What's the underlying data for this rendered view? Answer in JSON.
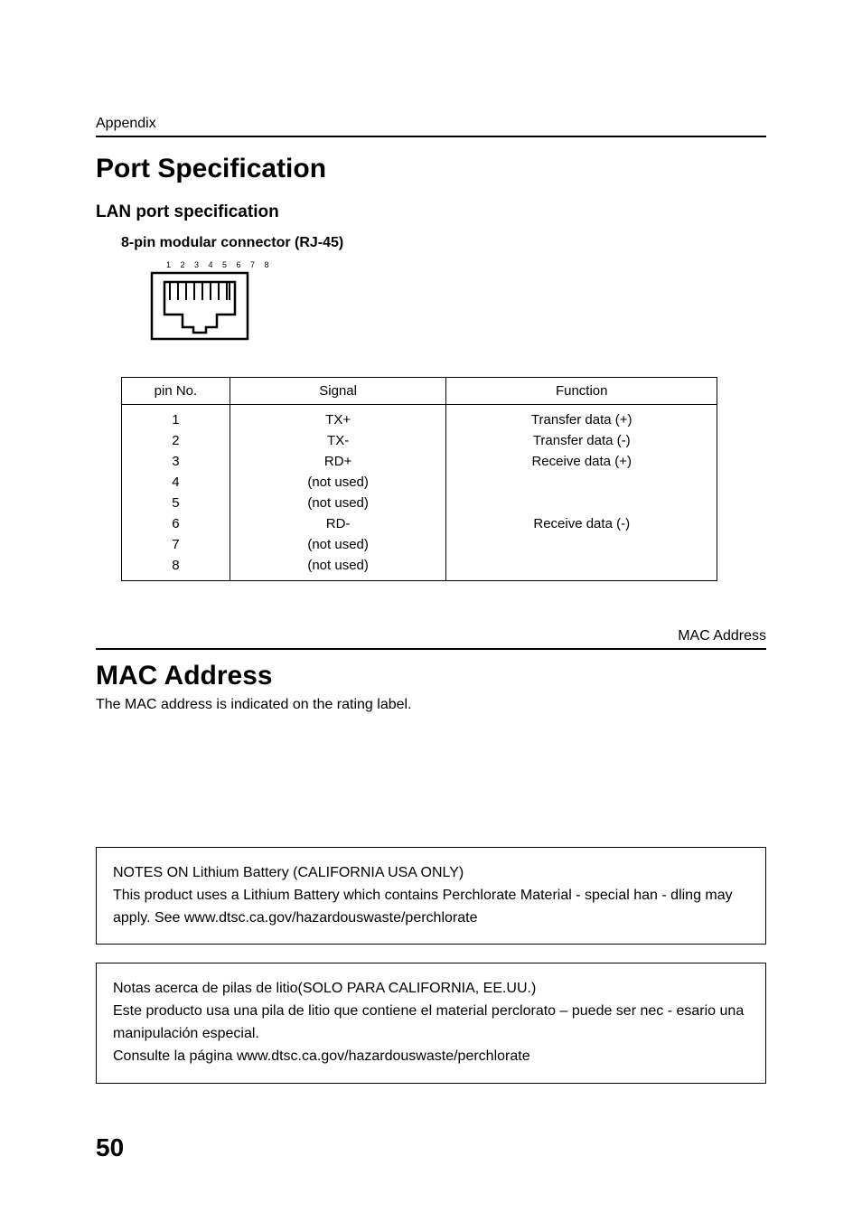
{
  "header": {
    "section_label": "Appendix",
    "mac_running_head": "MAC Address"
  },
  "port_spec": {
    "title": "Port Specification",
    "subtitle": "LAN port specification",
    "connector_label": "8-pin modular connector (RJ-45)",
    "pin_numbers": "1 2 3 4 5 6 7 8",
    "table": {
      "headers": [
        "pin No.",
        "Signal",
        "Function"
      ],
      "rows": [
        {
          "pin": "1",
          "signal": "TX+",
          "function": "Transfer data (+)"
        },
        {
          "pin": "2",
          "signal": "TX-",
          "function": "Transfer data (-)"
        },
        {
          "pin": "3",
          "signal": "RD+",
          "function": "Receive data (+)"
        },
        {
          "pin": "4",
          "signal": "(not used)",
          "function": ""
        },
        {
          "pin": "5",
          "signal": "(not used)",
          "function": ""
        },
        {
          "pin": "6",
          "signal": "RD-",
          "function": "Receive data (-)"
        },
        {
          "pin": "7",
          "signal": "(not used)",
          "function": ""
        },
        {
          "pin": "8",
          "signal": "(not used)",
          "function": ""
        }
      ]
    }
  },
  "mac": {
    "title": "MAC Address",
    "body": "The MAC address is indicated on the rating label."
  },
  "notes": {
    "box1_title": "NOTES ON Lithium Battery (CALIFORNIA USA ONLY)",
    "box1_body": "This product uses a Lithium Battery which contains Perchlorate Material - special han - dling may apply. See www.dtsc.ca.gov/hazardouswaste/perchlorate",
    "box2_title": "Notas acerca de pilas de litio(SOLO PARA CALIFORNIA, EE.UU.)",
    "box2_body1": "Este producto usa una pila de litio que contiene el material perclorato – puede ser nec - esario una manipulación especial.",
    "box2_body2": "Consulte la página www.dtsc.ca.gov/hazardouswaste/perchlorate"
  },
  "page_number": "50"
}
